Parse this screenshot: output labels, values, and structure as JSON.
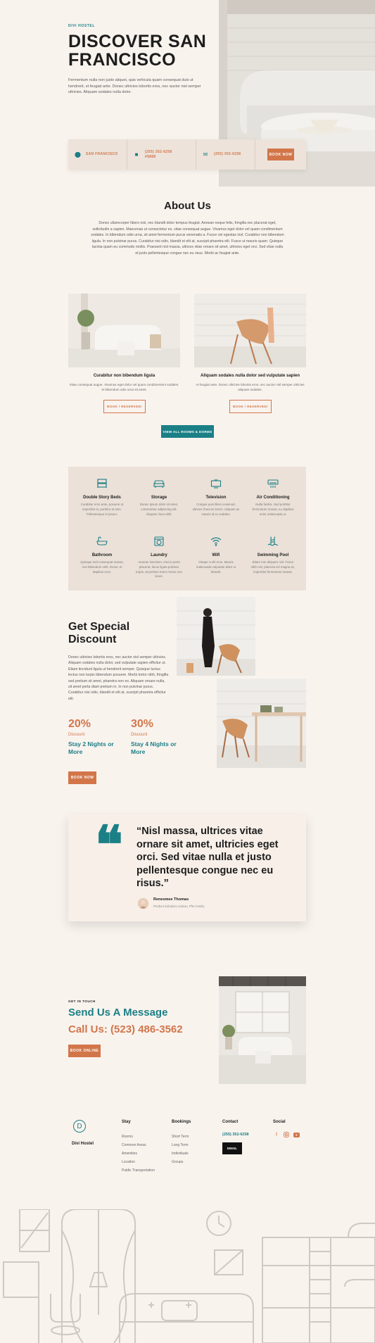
{
  "hero": {
    "label": "DIVI HOSTEL",
    "title": "DISCOVER SAN FRANCISCO",
    "text": "Fermentum nulla non justo aliquet, quis vehicula quam consequat duis ut hendrerit, et feugiat ante. Donec ultricies lobortis eros, nec auctor nisl semper ultricies. Aliquam sodales nulla dolor."
  },
  "info_bar": {
    "location": "SAN FRANCISCO",
    "address_line1": "(255) 352-6258",
    "address_line2": "#5888",
    "phone": "(255) 352-6258",
    "book_label": "BOOK NOW"
  },
  "about": {
    "title": "About Us",
    "text": "Donec ullamcorper libero nisl, nec blandit dolor tempus feugiat. Aenean neque felis, fringilla nec placerat eget, sollicitudin a sapien. Maecenas ut consectetur ex, vitae consequat augue. Vivamus eget dolor vel quam condimentum sodales. In bibendum odio urna, sit amet fermentum purus venenatis a. Fusce vel egestas nisl. Curabitur non bibendum ligula. In non pulvinar purus. Curabitur nisi odio, blandit et elit at, suscipit pharetra elit. Fusce ut mauris quam. Quisque lacinia quam eu commodo mollis. Praesent nisl massa, ultrices vitae ornare sit amet, ultricies eget orci. Sed vitae nulla et justo pellentesque congue nec eu risus. Morbi ac feugiat ante."
  },
  "rooms": [
    {
      "title": "Curabitur non bibendum ligula",
      "desc": "Vitae consequat augue. Vivamus eget dolor vel quam condimentum sodales. In bibendum odio urna sit amet.",
      "button": "BOOK / RESERVED!"
    },
    {
      "title": "Aliquam sodales nulla dolor sed vulputate sapien",
      "desc": "At feugiat ante. Donec ultricies lobortis eros, nec auctor nisl semper ultricies aliquam sodales.",
      "button": "BOOK / RESERVED!"
    }
  ],
  "view_all_label": "VIEW ALL ROOMS & DORMS",
  "amenities": [
    {
      "icon": "bed-icon",
      "title": "Double Story Beds",
      "desc": "Curabitur eros ante, posuere ut imperdiet et, porttitor at sem. Pellentesque in ipsum."
    },
    {
      "icon": "sofa-icon",
      "title": "Storage",
      "desc": "Donec ipsum dolor sit amet, consectetur adipiscing elit. Aliquam risus nibh."
    },
    {
      "icon": "tv-icon",
      "title": "Television",
      "desc": "Congue quis libero euismod, ultrices rhoncus lorem. Aliquam ac mauris id ex sodales."
    },
    {
      "icon": "ac-icon",
      "title": "Air Conditioning",
      "desc": "Nulla facilisi. Sed porttitor fermentum massa, eu dapibus enim malesuada ut."
    },
    {
      "icon": "bathtub-icon",
      "title": "Bathroom",
      "desc": "Quisque sed consequat massa, non bibendum velit. Donec et dapibus eros."
    },
    {
      "icon": "washer-icon",
      "title": "Laundry",
      "desc": "Aenean interdum, erat in porta placerat, lacus ligula pulvinar turpis, at pretium tortor metus non lacus."
    },
    {
      "icon": "wifi-icon",
      "title": "Wifi",
      "desc": "Integer a elit eros. Mauris malesuada vulputate diam ut blandit."
    },
    {
      "icon": "pool-icon",
      "title": "Swimming Pool",
      "desc": "Etiam non aliquam nisl. Fusce nibh nisl, placerat vel magna ac, imperdiet fermentum massa."
    }
  ],
  "discount": {
    "title": "Get Special Discount",
    "text": "Donec ultricies lobortis eros, nec auctor nisl semper ultricies. Aliquam sodales nulla dolor, sed vulputate sapien efficitur ut. Etiam tincidunt ligula ut hendrerit semper. Quisque luctus lectus non turpis bibendum posuere. Morbi tortor nibh, fringilla sed pretium sit amet, pharetra non ex. Aliquam ornare nulla, sit amet porta diam pretium in. In non pulvinar purus. Curabitur nisi odio, blandit et elit at, suscipit pharetra efficitur elit.",
    "offer1_pct": "20%",
    "offer1_label": "Discount",
    "offer1_stay": "Stay 2 Nights or More",
    "offer2_pct": "30%",
    "offer2_label": "Discount",
    "offer2_stay": "Stay 4 Nights or More",
    "button": "BOOK NOW"
  },
  "quote": {
    "text": "“Nisl massa, ultrices vitae ornare sit amet, ultricies eget orci. Sed vitae nulla et justo pellentesque congue nec eu risus.”",
    "name": "Renesmee Thomas",
    "role": "Product Solutions Liaison, Pfet Family"
  },
  "contact": {
    "label": "GET IN TOUCH",
    "title": "Send Us A Message",
    "phone": "Call Us: (523) 486-3562",
    "button": "BOOK ONLINE"
  },
  "footer": {
    "logo_letter": "D",
    "logo_name": "Divi Hostel",
    "stay_head": "Stay",
    "stay_items": [
      "Rooms",
      "Common Areas",
      "Amenities",
      "Location",
      "Public Transportation"
    ],
    "bookings_head": "Bookings",
    "bookings_items": [
      "Short Term",
      "Long Term",
      "Individuals",
      "Groups"
    ],
    "contact_head": "Contact",
    "contact_phone": "(255) 352-6258",
    "email_label": "EMAIL",
    "social_head": "Social",
    "social_icons": [
      "facebook-icon",
      "instagram-icon",
      "youtube-icon"
    ]
  },
  "colors": {
    "teal": "#1b7f86",
    "orange": "#d2764a",
    "background": "#f9f3ee",
    "panel": "#ebe1d8"
  }
}
